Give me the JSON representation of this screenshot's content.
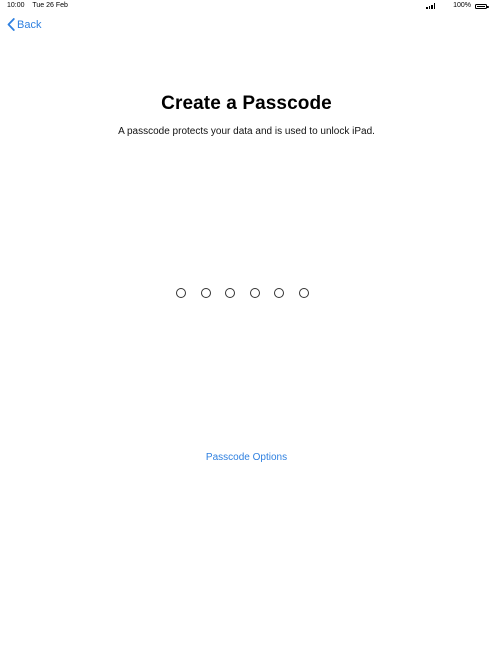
{
  "status_bar": {
    "time": "10:00",
    "date": "Tue 26 Feb",
    "battery": "100%"
  },
  "nav": {
    "back_label": "Back"
  },
  "main": {
    "title": "Create a Passcode",
    "subtitle": "A passcode protects your data and is used to unlock iPad.",
    "options_label": "Passcode Options"
  },
  "passcode": {
    "length": 6,
    "entered": 0
  },
  "colors": {
    "accent": "#2f80e0"
  }
}
